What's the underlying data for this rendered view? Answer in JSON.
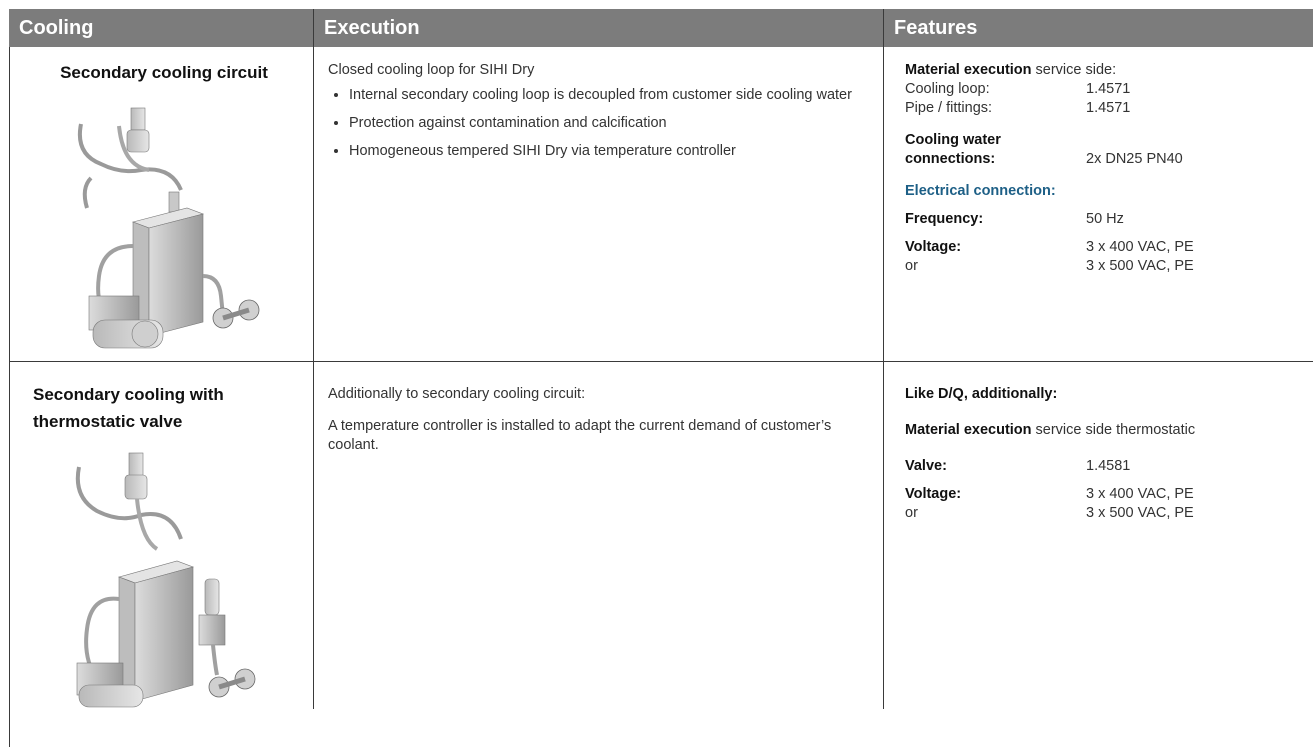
{
  "headers": {
    "cooling": "Cooling",
    "execution": "Execution",
    "features": "Features"
  },
  "rows": [
    {
      "name": "Secondary cooling circuit",
      "execution": {
        "intro": "Closed cooling loop for SIHI Dry",
        "bullets": [
          "Internal secondary cooling loop is decoupled from customer side cooling water",
          "Protection against contamination and calcification",
          "Homogeneous tempered SIHI Dry via temperature controller"
        ]
      },
      "features": {
        "material_bold": "Material execution",
        "material_rest": " service side:",
        "cooling_loop_key": "Cooling loop:",
        "cooling_loop_val": "1.4571",
        "pipe_key": "Pipe / fittings:",
        "pipe_val": "1.4571",
        "water_key1": "Cooling water",
        "water_key2": "connections:",
        "water_val": "2x DN25 PN40",
        "electrical": "Electrical connection:",
        "freq_key": "Frequency:",
        "freq_val": "50 Hz",
        "volt_key": "Voltage:",
        "volt_val": "3 x 400 VAC, PE",
        "or_key": "or",
        "or_val": "3 x 500 VAC, PE"
      }
    },
    {
      "name_line1": "Secondary cooling with",
      "name_line2": "thermostatic valve",
      "execution": {
        "intro": "Additionally to secondary cooling circuit:",
        "text": "A temperature controller is installed to adapt the current demand of customer’s coolant."
      },
      "features": {
        "like": "Like D/Q, additionally:",
        "material_bold": "Material execution",
        "material_rest": " service side thermostatic",
        "valve_key": "Valve:",
        "valve_val": "1.4581",
        "volt_key": "Voltage:",
        "volt_val": "3 x 400 VAC, PE",
        "or_key": "or",
        "or_val": "3 x 500 VAC, PE"
      }
    }
  ]
}
